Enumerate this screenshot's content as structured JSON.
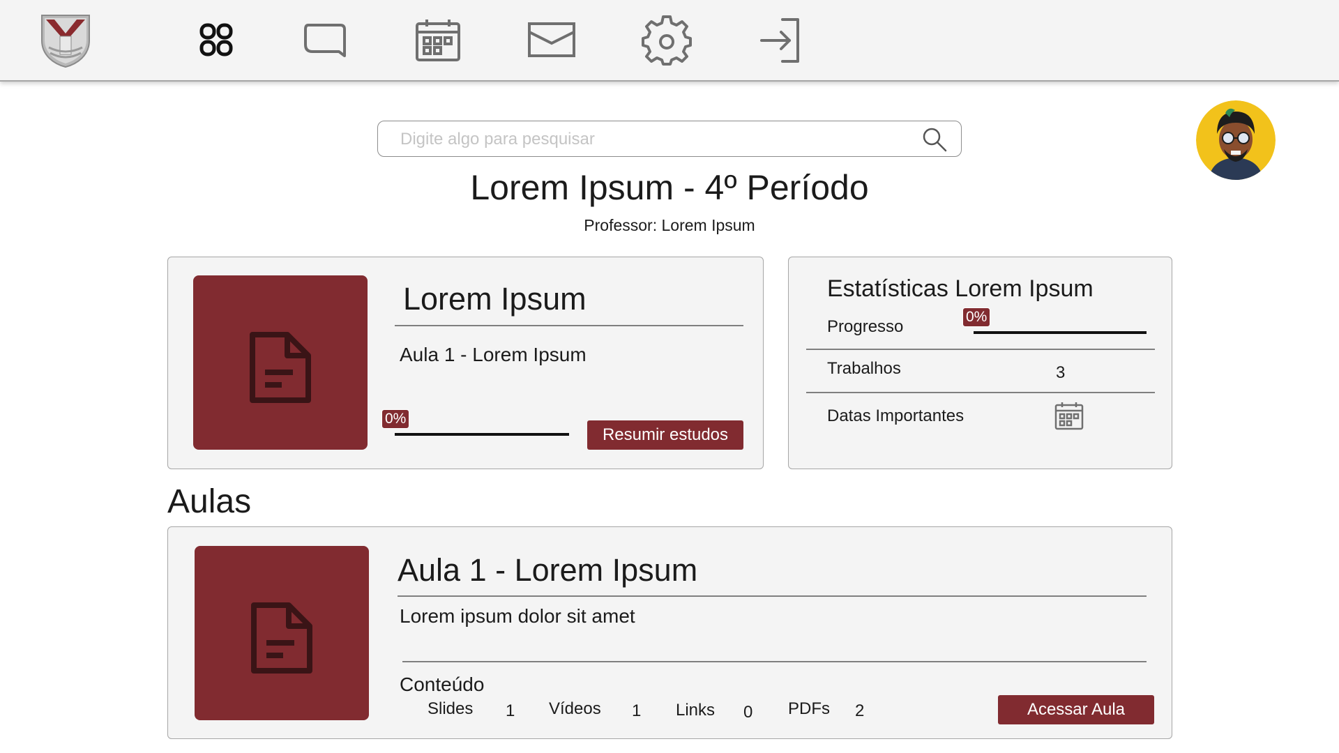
{
  "nav": {
    "logo": "university-crest-logo",
    "icons": [
      "grid-icon",
      "chat-bubble-icon",
      "calendar-icon",
      "mail-icon",
      "gear-icon",
      "logout-icon"
    ]
  },
  "search": {
    "placeholder": "Digite algo para pesquisar",
    "value": ""
  },
  "page": {
    "title": "Lorem Ipsum - 4º Período",
    "subtitle": "Professor: Lorem Ipsum"
  },
  "summary_card": {
    "title": "Lorem Ipsum",
    "lesson": "Aula 1 - Lorem Ipsum",
    "progress_label": "0%",
    "progress": 0,
    "button": "Resumir estudos"
  },
  "stats_card": {
    "title": "Estatísticas Lorem Ipsum",
    "progress_label": "Progresso",
    "progress_value": "0%",
    "progress": 0,
    "trabalhos_label": "Trabalhos",
    "trabalhos_value": "3",
    "datas_label": "Datas Importantes"
  },
  "section": {
    "title": "Aulas"
  },
  "lesson_card": {
    "title": "Aula 1 - Lorem Ipsum",
    "description": "Lorem ipsum dolor sit amet",
    "content_label": "Conteúdo",
    "counts": [
      {
        "label": "Slides",
        "value": "1"
      },
      {
        "label": "Vídeos",
        "value": "1"
      },
      {
        "label": "Links",
        "value": "0"
      },
      {
        "label": "PDFs",
        "value": "2"
      }
    ],
    "button": "Acessar Aula"
  },
  "colors": {
    "accent": "#812b30",
    "card_bg": "#f4f4f4",
    "border": "#a6a6a6",
    "avatar_bg": "#f2c21b"
  }
}
